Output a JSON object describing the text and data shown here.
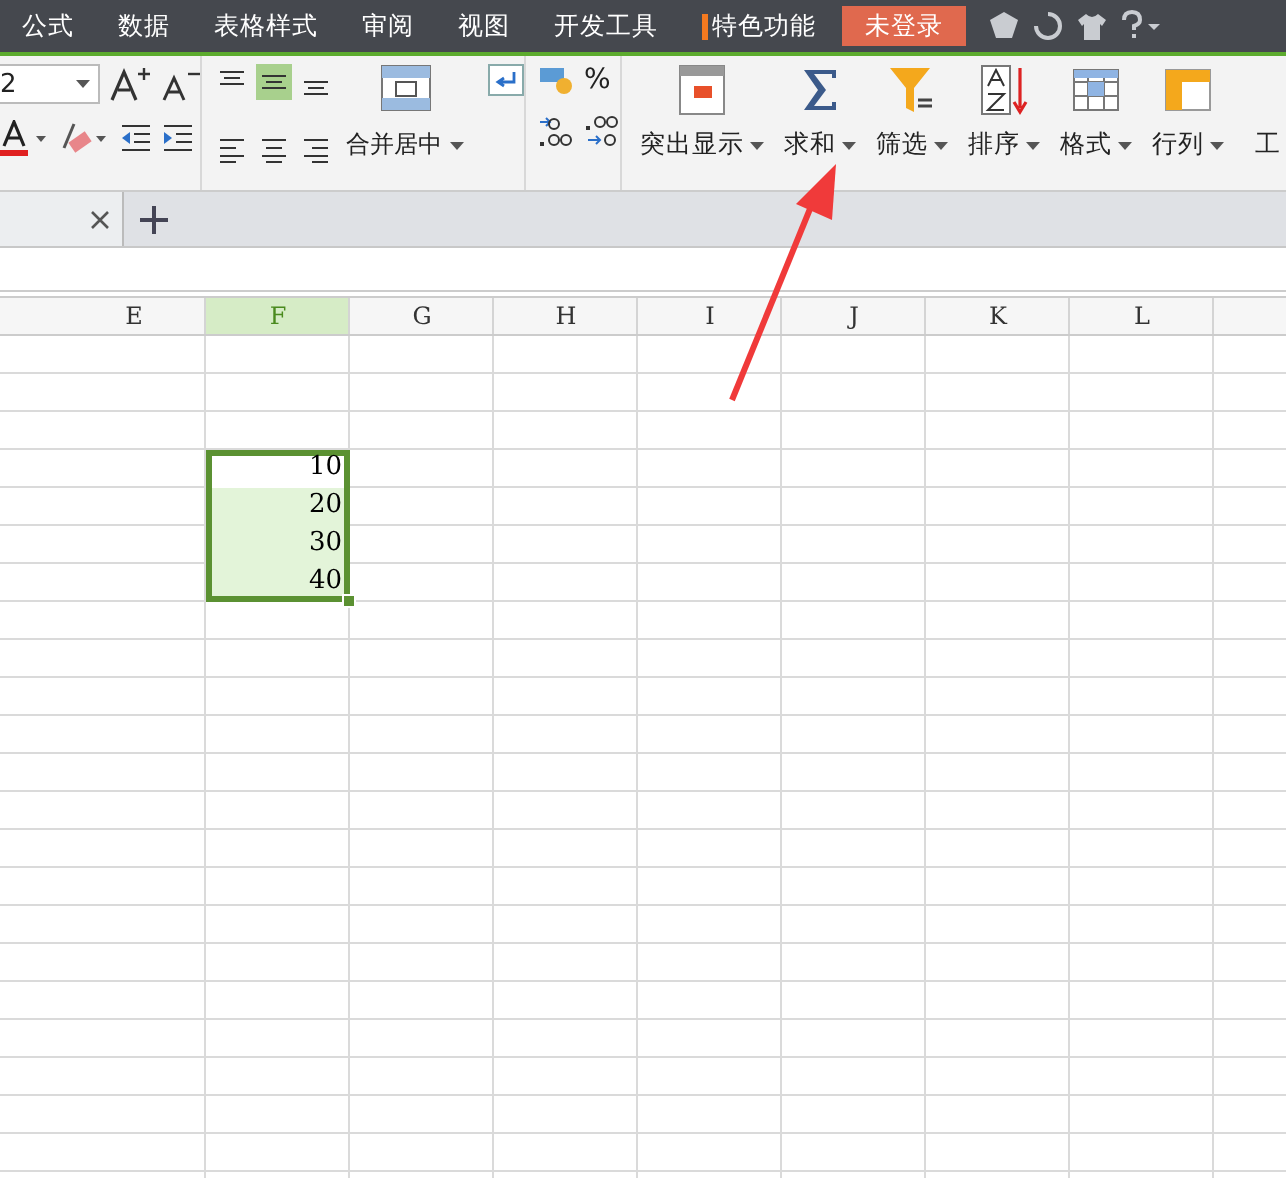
{
  "menu": {
    "tabs": [
      {
        "label": "公式",
        "kind": "plain"
      },
      {
        "label": "数据",
        "kind": "plain"
      },
      {
        "label": "表格样式",
        "kind": "plain"
      },
      {
        "label": "审阅",
        "kind": "plain"
      },
      {
        "label": "视图",
        "kind": "plain"
      },
      {
        "label": "开发工具",
        "kind": "plain"
      },
      {
        "label": "特色功能",
        "kind": "featured"
      }
    ],
    "login": "未登录"
  },
  "ribbon": {
    "font_size": "2",
    "merge_label": "合并居中",
    "percent": "%",
    "commands": [
      {
        "label": "突出显示",
        "kind": "highlight"
      },
      {
        "label": "求和",
        "kind": "sum"
      },
      {
        "label": "筛选",
        "kind": "filter"
      },
      {
        "label": "排序",
        "kind": "sort"
      },
      {
        "label": "格式",
        "kind": "format"
      },
      {
        "label": "行列",
        "kind": "rowcol"
      },
      {
        "label": "工",
        "kind": "cut"
      }
    ]
  },
  "sheet": {
    "columns": [
      {
        "label": "E",
        "selected": false
      },
      {
        "label": "F",
        "selected": true
      },
      {
        "label": "G",
        "selected": false
      },
      {
        "label": "H",
        "selected": false
      },
      {
        "label": "I",
        "selected": false
      },
      {
        "label": "J",
        "selected": false
      },
      {
        "label": "K",
        "selected": false
      },
      {
        "label": "L",
        "selected": false
      }
    ],
    "cells": [
      {
        "value": "10",
        "selected": true,
        "active": true
      },
      {
        "value": "20",
        "selected": true,
        "active": false
      },
      {
        "value": "30",
        "selected": true,
        "active": false
      },
      {
        "value": "40",
        "selected": true,
        "active": false
      }
    ]
  }
}
